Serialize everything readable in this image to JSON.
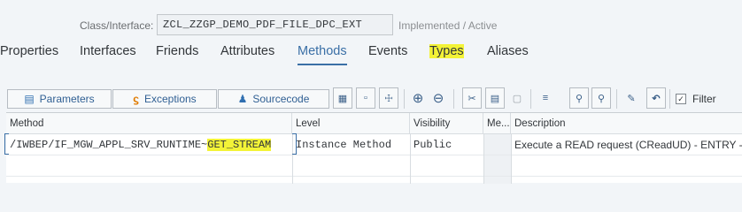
{
  "header": {
    "class_label": "Class/Interface:",
    "class_value": "ZCL_ZZGP_DEMO_PDF_FILE_DPC_EXT",
    "status": "Implemented / Active"
  },
  "tabs": [
    {
      "label": "Properties"
    },
    {
      "label": "Interfaces"
    },
    {
      "label": "Friends"
    },
    {
      "label": "Attributes"
    },
    {
      "label": "Methods",
      "active": true
    },
    {
      "label": "Events"
    },
    {
      "label": "Types",
      "highlighted": true
    },
    {
      "label": "Aliases"
    }
  ],
  "toolbar": {
    "parameters_label": "Parameters",
    "exceptions_label": "Exceptions",
    "sourcecode_label": "Sourcecode",
    "filter_label": "Filter",
    "filter_checked": true,
    "icons": [
      "pin-icon",
      "copy-icon",
      "tree-icon",
      "plus-icon",
      "minus-icon",
      "cut-icon",
      "copy2-icon",
      "paste-icon",
      "align-icon",
      "search-icon",
      "search-next-icon",
      "edit-icon",
      "undo-icon"
    ]
  },
  "table": {
    "columns": [
      "Method",
      "Level",
      "Visibility",
      "Me...",
      "Description"
    ],
    "rows": [
      {
        "method_prefix": "/IWBEP/IF_MGW_APPL_SRV_RUNTIME~",
        "method_highlight": "GET_STREAM",
        "level": "Instance Method",
        "visibility": "Public",
        "me": "",
        "description": "Execute a READ request (CReadUD) - ENTRY -"
      }
    ]
  },
  "colors": {
    "accent": "#3a6fa6",
    "highlight": "#f3f337",
    "background": "#f2f5f8"
  }
}
